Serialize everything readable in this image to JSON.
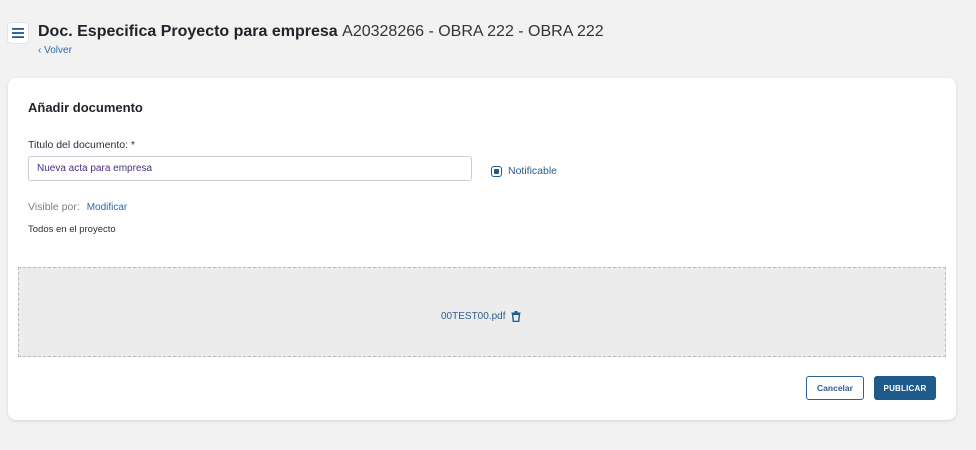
{
  "header": {
    "title_bold": "Doc. Especifica Proyecto para empresa",
    "title_rest": "A20328266 - OBRA 222 - OBRA 222",
    "back_label": "‹ Volver"
  },
  "form": {
    "heading": "Añadir documento",
    "title_label": "Titulo del documento: *",
    "title_value": "Nueva acta para empresa",
    "notifiable_label": "Notificable",
    "visible_label": "Visible por:",
    "modify_label": "Modificar",
    "visible_value": "Todos en el proyecto"
  },
  "upload": {
    "file_name": "00TEST00.pdf"
  },
  "actions": {
    "cancel_label": "Cancelar",
    "publish_label": "PUBLICAR"
  },
  "colors": {
    "primary": "#1f5a8c",
    "link": "#2d6aa6",
    "background": "#f2f2f3"
  },
  "icons": {
    "menu": "hamburger-menu-icon",
    "notifiable": "checkbox-checked-icon",
    "delete_file": "trash-icon"
  }
}
